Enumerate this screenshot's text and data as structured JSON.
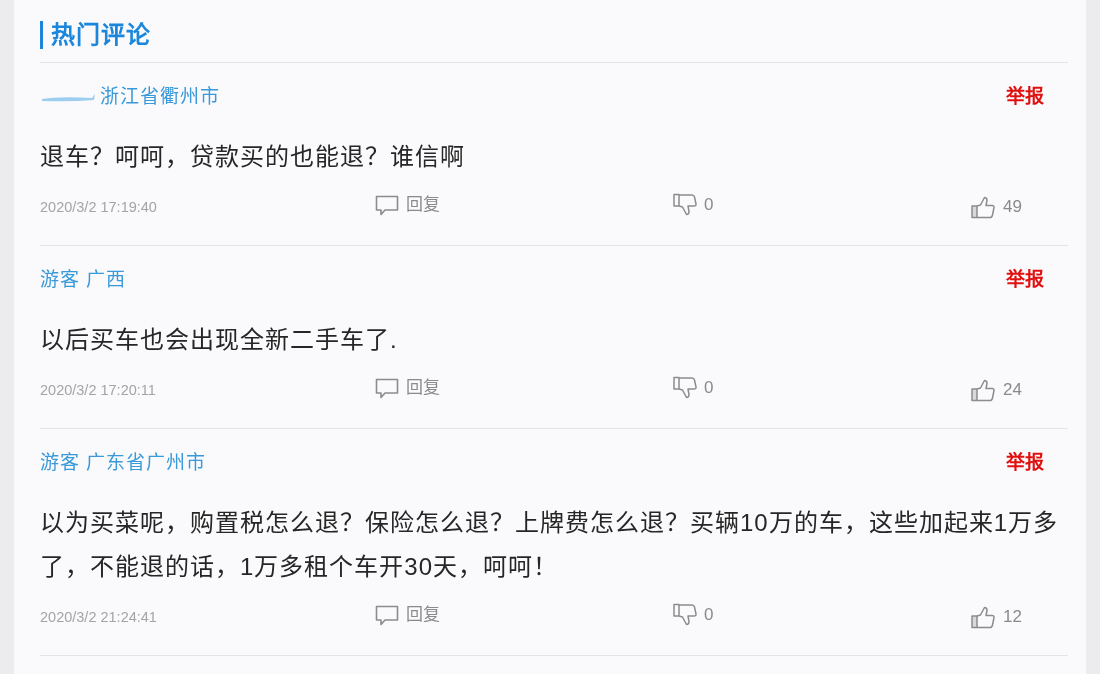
{
  "section_title": "热门评论",
  "comments": [
    {
      "name_blurred": true,
      "author": "浙江省衢州市",
      "report": "举报",
      "text": "退车？呵呵，贷款买的也能退？谁信啊",
      "time": "2020/3/2 17:19:40",
      "reply": "回复",
      "dislikes": "0",
      "likes": "49"
    },
    {
      "name_blurred": false,
      "author": "游客 广西",
      "report": "举报",
      "text": "以后买车也会出现全新二手车了.",
      "time": "2020/3/2 17:20:11",
      "reply": "回复",
      "dislikes": "0",
      "likes": "24"
    },
    {
      "name_blurred": false,
      "author": "游客 广东省广州市",
      "report": "举报",
      "text": "以为买菜呢，购置税怎么退？保险怎么退？上牌费怎么退？买辆10万的车，这些加起来1万多了，不能退的话，1万多租个车开30天，呵呵！",
      "time": "2020/3/2 21:24:41",
      "reply": "回复",
      "dislikes": "0",
      "likes": "12"
    }
  ]
}
